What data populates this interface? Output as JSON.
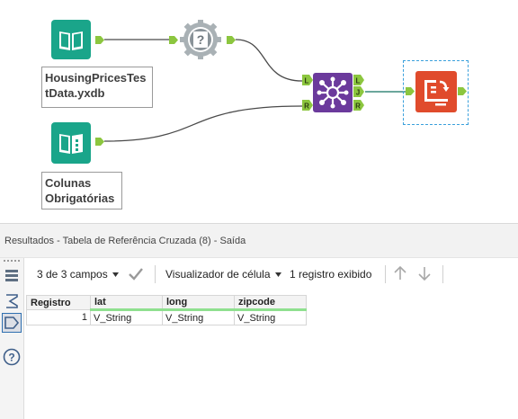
{
  "canvas": {
    "input_tool_1": {
      "annotation": "HousingPricesTes\ntData.yxdb"
    },
    "input_tool_2": {
      "annotation": "Colunas\nObrigatórias"
    },
    "join_tool": {
      "anchor_left_top": "L",
      "anchor_left_bottom": "R",
      "anchor_right_top": "L",
      "anchor_right_mid": "J",
      "anchor_right_bottom": "R"
    },
    "colors": {
      "input_teal": "#1aa58a",
      "wire": "#4a4a4a",
      "join_wire": "#3a8a7c",
      "join_purple": "#6b3a9c",
      "crosstab_red": "#e04b2c",
      "anchor_green": "#8cc63f",
      "selection": "#3aa0dc"
    }
  },
  "results": {
    "title": "Resultados - Tabela de Referência Cruzada (8) - Saída",
    "toolbar": {
      "fields_label": "3 de 3 campos",
      "cell_viewer_label": "Visualizador de célula",
      "records_label": "1 registro exibido"
    },
    "grid": {
      "headers": [
        "Registro",
        "lat",
        "long",
        "zipcode"
      ],
      "rows": [
        {
          "record": "1",
          "cells": [
            "V_String",
            "V_String",
            "V_String"
          ]
        }
      ]
    }
  }
}
